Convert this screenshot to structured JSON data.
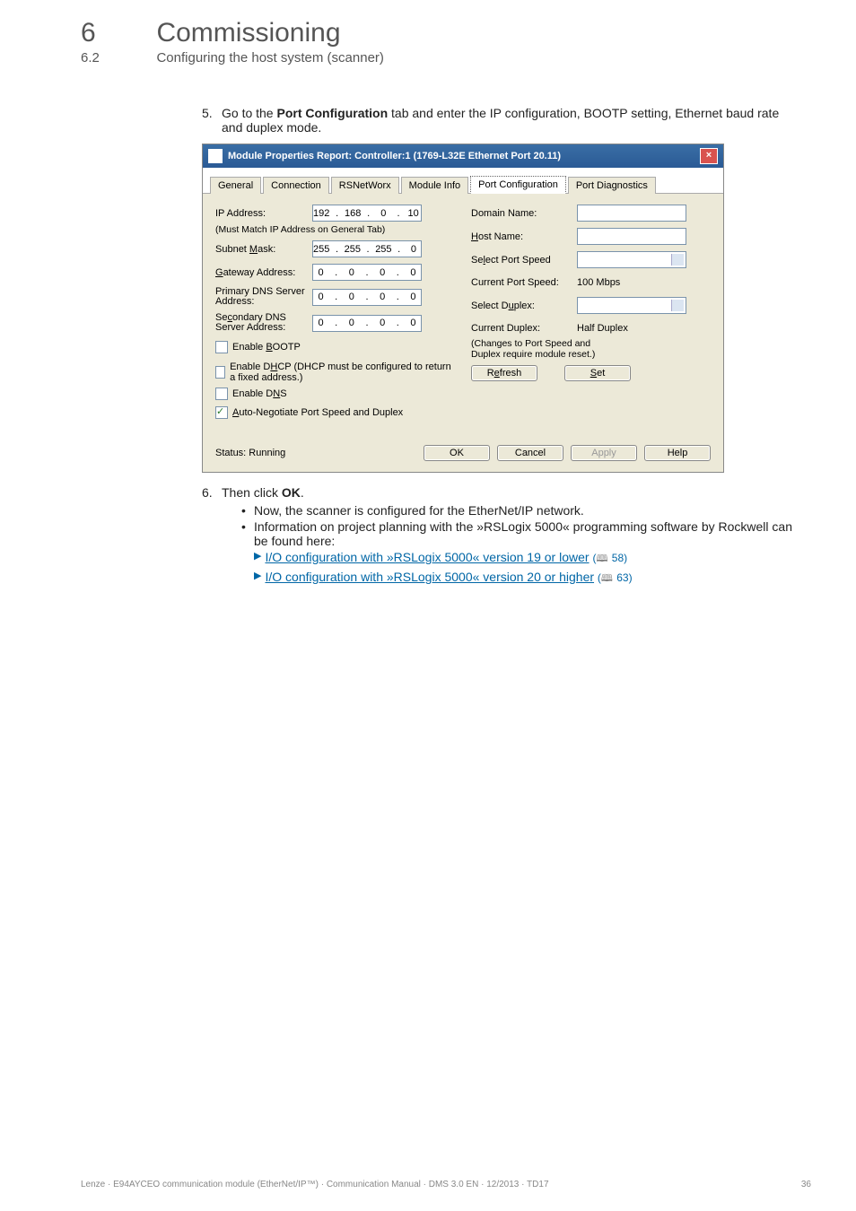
{
  "header": {
    "chapter_number": "6",
    "chapter_title": "Commissioning",
    "section_number": "6.2",
    "section_title": "Configuring the host system (scanner)"
  },
  "dashes": "_ _ _ _ _ _ _ _ _ _ _ _ _ _ _ _ _ _ _ _ _ _ _ _ _ _ _ _ _ _ _ _ _ _ _ _ _ _ _ _ _ _ _ _ _ _ _ _ _ _ _ _ _ _ _ _ _ _ _ _ _ _ _ _",
  "steps": {
    "s5": {
      "num": "5.",
      "pre": "Go to the ",
      "bold": "Port Configuration",
      "post": " tab and enter the IP configuration, BOOTP setting, Ethernet baud rate and duplex mode."
    },
    "s6": {
      "num": "6.",
      "pre": "Then click ",
      "bold": "OK",
      "post": ".",
      "b1": "Now, the scanner is configured for the EtherNet/IP network.",
      "b2": "Information on project planning with the »RSLogix 5000« programming software by Rockwell can be found here:",
      "l1_text": "I/O configuration with »RSLogix 5000« version 19 or lower",
      "l1_page": " 58)",
      "l1_open": "(",
      "l2_text": "I/O configuration with »RSLogix 5000« version 20 or higher",
      "l2_page": " 63)",
      "l2_open": "("
    }
  },
  "dialog": {
    "title": "Module Properties Report: Controller:1 (1769-L32E Ethernet Port 20.11)",
    "tabs": {
      "general": "General",
      "connection": "Connection",
      "rsnetworx": "RSNetWorx",
      "moduleinfo": "Module Info",
      "portconfig": "Port Configuration",
      "portdiag": "Port Diagnostics"
    },
    "left": {
      "ip_label": "IP Address:",
      "ip": {
        "a": "192",
        "b": "168",
        "c": "0",
        "d": "10"
      },
      "must_match": "(Must Match IP Address on General Tab)",
      "subnet_label_pre": "Subnet ",
      "subnet_label_u": "M",
      "subnet_label_post": "ask:",
      "subnet": {
        "a": "255",
        "b": "255",
        "c": "255",
        "d": "0"
      },
      "gateway_label_u": "G",
      "gateway_label_post": "ateway Address:",
      "gateway": {
        "a": "0",
        "b": "0",
        "c": "0",
        "d": "0"
      },
      "pdns_label": "Primary DNS Server Address:",
      "pdns": {
        "a": "0",
        "b": "0",
        "c": "0",
        "d": "0"
      },
      "sdns_label_pre": "Se",
      "sdns_label_u": "c",
      "sdns_label_post": "ondary DNS Server Address:",
      "sdns": {
        "a": "0",
        "b": "0",
        "c": "0",
        "d": "0"
      },
      "chk_bootp_pre": "Enable ",
      "chk_bootp_u": "B",
      "chk_bootp_post": "OOTP",
      "chk_dhcp_pre": "Enable D",
      "chk_dhcp_u": "H",
      "chk_dhcp_post": "CP  (DHCP must be configured to return a fixed address.)",
      "chk_dns_pre": "Enable D",
      "chk_dns_u": "N",
      "chk_dns_post": "S",
      "chk_auto_u": "A",
      "chk_auto_post": "uto-Negotiate Port Speed and Duplex"
    },
    "right": {
      "domain_label": "Domain Name:",
      "host_label_u": "H",
      "host_label_post": "ost Name:",
      "selspeed_pre": "Se",
      "selspeed_u": "l",
      "selspeed_post": "ect Port Speed",
      "curspeed_label": "Current Port Speed:",
      "curspeed_value": "100 Mbps",
      "selduplex_pre": "Select D",
      "selduplex_u": "u",
      "selduplex_post": "plex:",
      "curduplex_label": "Current Duplex:",
      "curduplex_value": "Half Duplex",
      "changes_note1": "(Changes to Port Speed and",
      "changes_note2": "Duplex require module reset.)",
      "refresh_pre": "R",
      "refresh_u": "e",
      "refresh_post": "fresh",
      "set_u": "S",
      "set_post": "et"
    },
    "footer": {
      "status": "Status: Running",
      "ok": "OK",
      "cancel": "Cancel",
      "apply": "Apply",
      "help": "Help"
    }
  },
  "footer": {
    "left": "Lenze · E94AYCEO communication module (EtherNet/IP™) · Communication Manual · DMS 3.0 EN · 12/2013 · TD17",
    "right": "36"
  }
}
